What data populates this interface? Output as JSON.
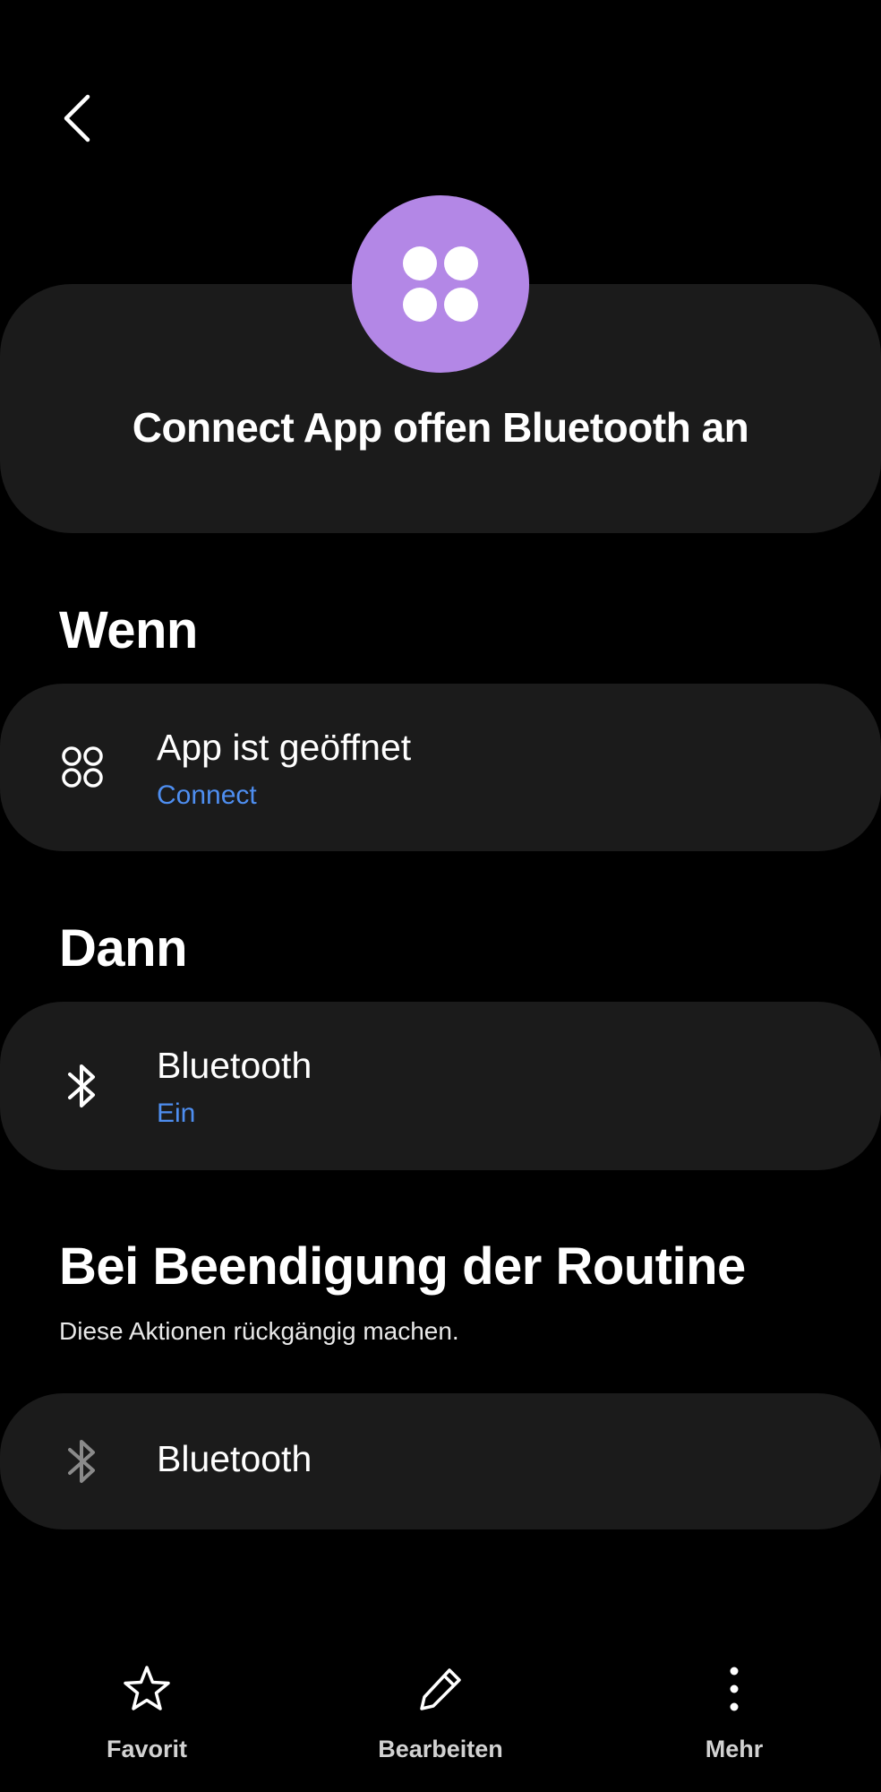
{
  "header": {
    "title": "Connect App offen Bluetooth an"
  },
  "sections": {
    "when": {
      "title": "Wenn",
      "card": {
        "title": "App ist geöffnet",
        "subtitle": "Connect",
        "icon": "apps-grid-icon"
      }
    },
    "then": {
      "title": "Dann",
      "card": {
        "title": "Bluetooth",
        "subtitle": "Ein",
        "icon": "bluetooth-icon"
      }
    },
    "on_end": {
      "title": "Bei Beendigung der Routine",
      "subtitle": "Diese Aktionen rückgängig machen.",
      "card": {
        "title": "Bluetooth",
        "icon": "bluetooth-icon"
      }
    }
  },
  "bottom_bar": {
    "favorite_label": "Favorit",
    "edit_label": "Bearbeiten",
    "more_label": "Mehr"
  },
  "colors": {
    "background": "#000000",
    "card": "#1b1b1b",
    "accent_icon": "#b387e6",
    "link_blue": "#4e8ef0"
  }
}
